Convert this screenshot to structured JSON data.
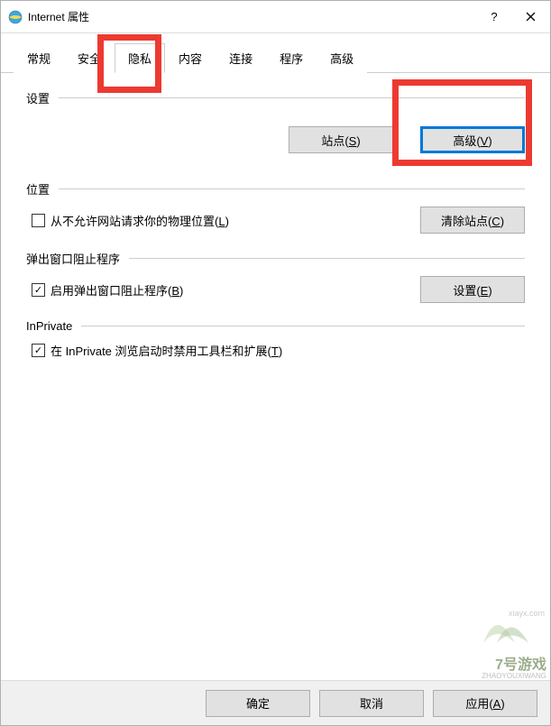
{
  "window": {
    "title": "Internet 属性"
  },
  "tabs": {
    "general": "常规",
    "security": "安全",
    "privacy": "隐私",
    "content": "内容",
    "connections": "连接",
    "programs": "程序",
    "advanced": "高级"
  },
  "sections": {
    "settings": {
      "label": "设置",
      "site_btn": "站点(S)",
      "site_btn_hotkey": "S",
      "adv_btn": "高级(V)",
      "adv_btn_hotkey": "V"
    },
    "location": {
      "label": "位置",
      "checkbox_label": "从不允许网站请求你的物理位置(L)",
      "checkbox_hotkey": "L",
      "checkbox_checked": false,
      "clear_btn": "清除站点(C)",
      "clear_btn_hotkey": "C"
    },
    "popup": {
      "label": "弹出窗口阻止程序",
      "checkbox_label": "启用弹出窗口阻止程序(B)",
      "checkbox_hotkey": "B",
      "checkbox_checked": true,
      "settings_btn": "设置(E)",
      "settings_btn_hotkey": "E"
    },
    "inprivate": {
      "label": "InPrivate",
      "checkbox_label": "在 InPrivate 浏览启动时禁用工具栏和扩展(T)",
      "checkbox_hotkey": "T",
      "checkbox_checked": true
    }
  },
  "footer": {
    "ok": "确定",
    "cancel": "取消",
    "apply": "应用(A)"
  },
  "watermark": {
    "line1": "7号游戏",
    "line2": "ZHAOYOUXIWANG",
    "url": "xiayx.com"
  }
}
